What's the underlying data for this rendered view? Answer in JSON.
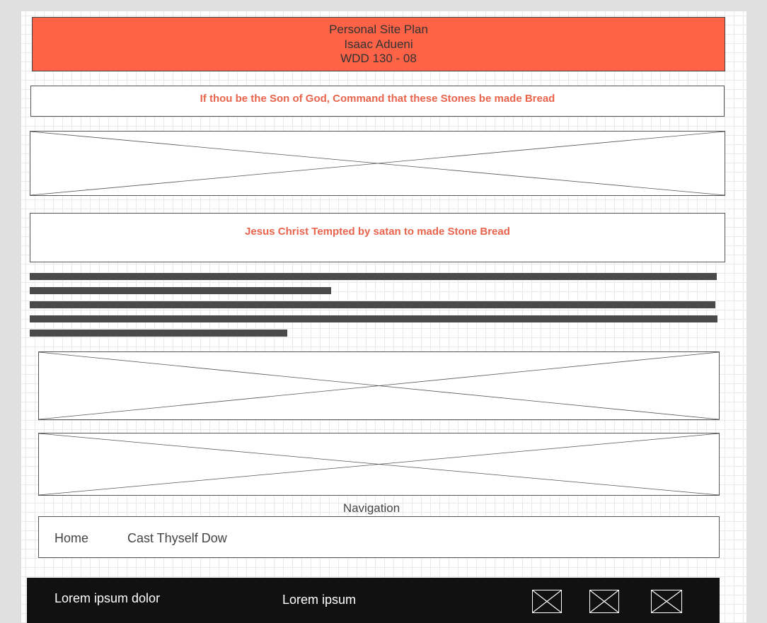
{
  "header": {
    "title": "Personal Site Plan",
    "author": "Isaac Adueni",
    "course": "WDD 130 - 08"
  },
  "quote": {
    "text": "If thou be the Son of God, Command that these Stones be made Bread"
  },
  "hero_placeholder": {
    "icon": "image-placeholder-icon"
  },
  "caption": {
    "text": "Jesus Christ Tempted by satan to made Stone Bread"
  },
  "body_text": {
    "icon": "text-lines-placeholder"
  },
  "navigation": {
    "title": "Navigation",
    "links": [
      "Home",
      "Cast Thyself Dow"
    ]
  },
  "footer": {
    "text_left": "Lorem ipsum dolor",
    "text_center": "Lorem ipsum",
    "icons": [
      "image-placeholder-icon",
      "image-placeholder-icon",
      "image-placeholder-icon"
    ]
  },
  "colors": {
    "header_bg": "#ff6347",
    "accent_text": "#e8644c",
    "footer_bg": "#111111"
  }
}
